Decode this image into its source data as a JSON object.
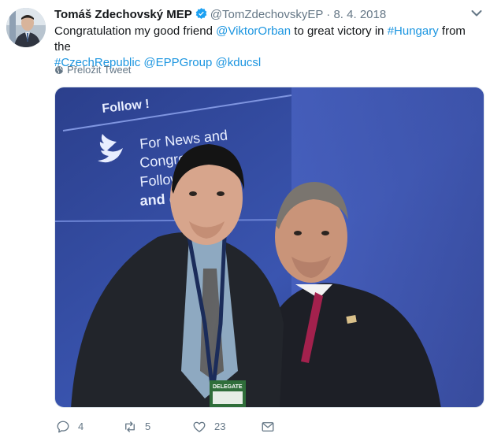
{
  "tweet": {
    "author_name": "Tomáš Zdechovský MEP",
    "handle": "@TomZdechovskyEP",
    "separator": "·",
    "date": "8. 4. 2018",
    "text_parts": [
      {
        "type": "text",
        "value": "Congratulation my good friend "
      },
      {
        "type": "mention",
        "value": "@ViktorOrban"
      },
      {
        "type": "text",
        "value": " to great victory in "
      },
      {
        "type": "hashtag",
        "value": "#Hungary"
      },
      {
        "type": "text",
        "value": " from the "
      },
      {
        "type": "hashtag",
        "value": "#CzechRepublic"
      },
      {
        "type": "text",
        "value": " "
      },
      {
        "type": "mention",
        "value": "@EPPGroup"
      },
      {
        "type": "text",
        "value": " "
      },
      {
        "type": "mention",
        "value": "@kducsl"
      }
    ],
    "translate_label": "Přeložit Tweet",
    "photo": {
      "banner_follow": "Follow !",
      "banner_line1": "For News and",
      "banner_line2": "Congress up",
      "banner_line3": "Follow @E",
      "banner_line4": "and @EP",
      "badge_text": "DELEGATE"
    },
    "actions": {
      "replies": "4",
      "retweets": "5",
      "likes": "23"
    }
  },
  "colors": {
    "link": "#1b95e0",
    "secondary": "#657786",
    "verified": "#1da1f2"
  },
  "icons": [
    "verified-badge-icon",
    "caret-down-icon",
    "globe-icon",
    "reply-icon",
    "retweet-icon",
    "like-icon",
    "message-icon"
  ]
}
